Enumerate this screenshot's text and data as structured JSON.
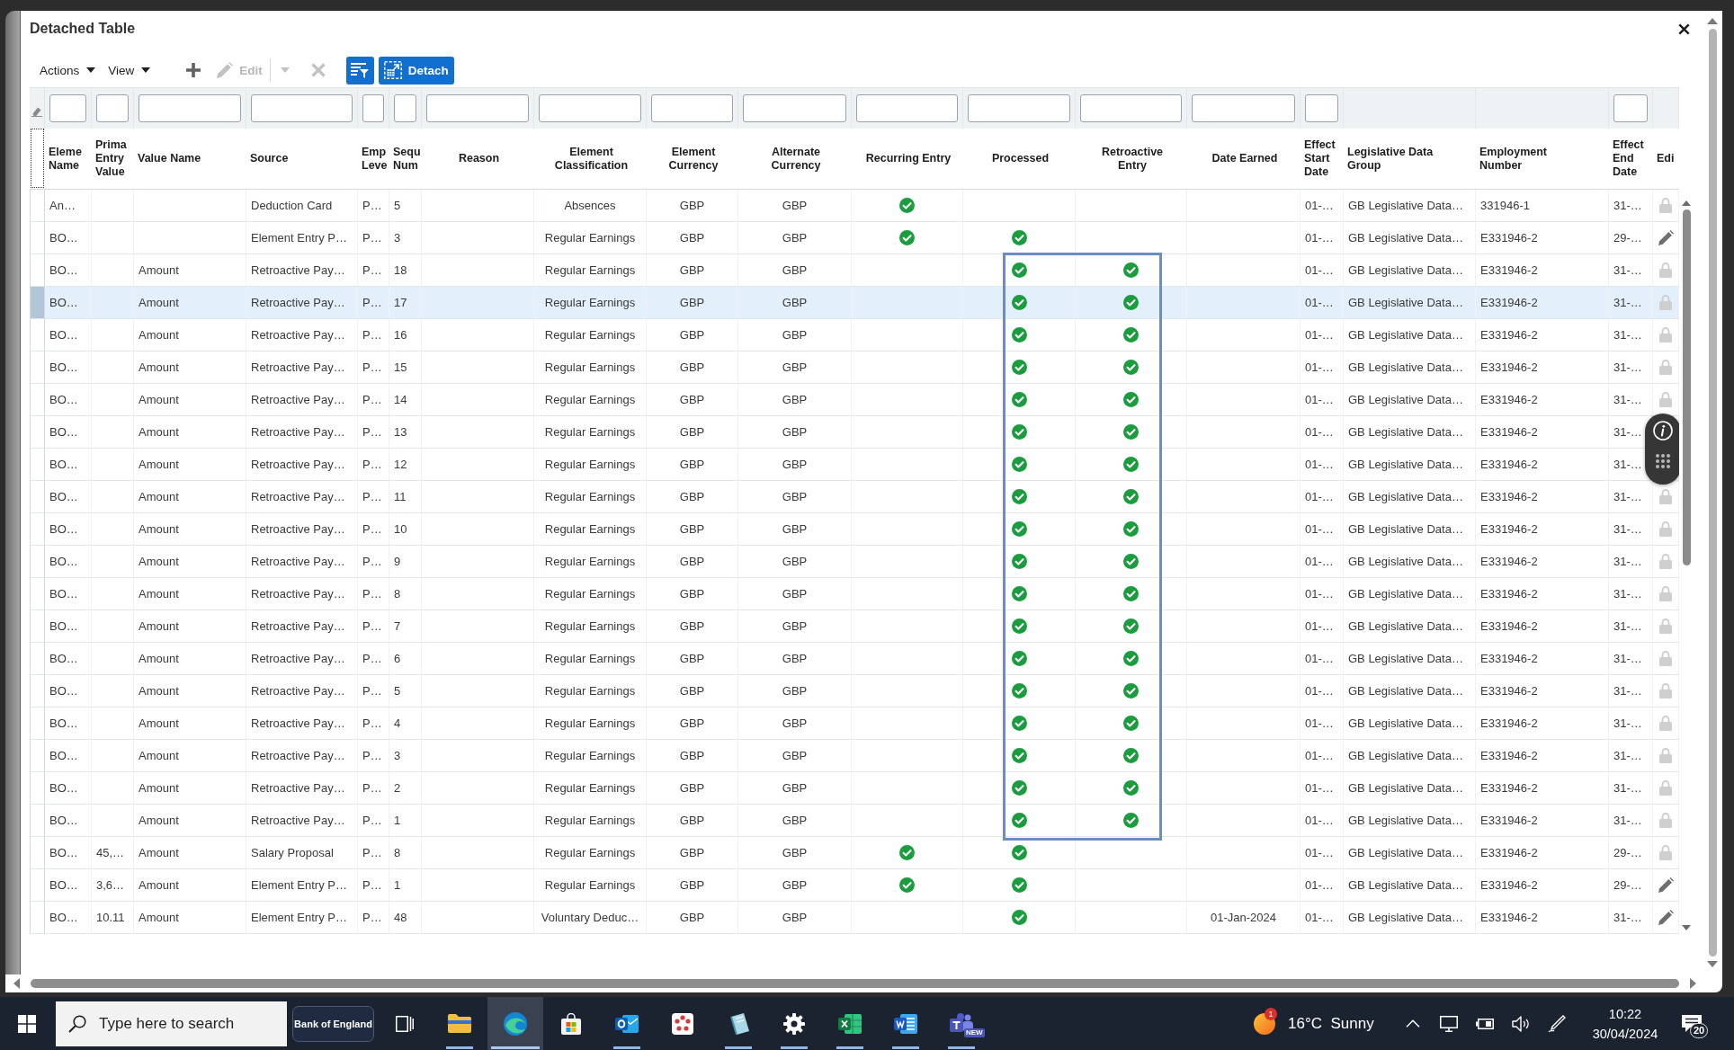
{
  "window": {
    "title": "Detached Table"
  },
  "toolbar": {
    "menus": [
      {
        "label": "Actions"
      },
      {
        "label": "View"
      }
    ],
    "buttons": [
      {
        "kind": "add",
        "disabled": false
      },
      {
        "kind": "edit",
        "label": "Edit",
        "disabled": true
      },
      {
        "kind": "dropdown",
        "disabled": true
      },
      {
        "kind": "delete",
        "disabled": true
      },
      {
        "kind": "filter",
        "disabled": false
      },
      {
        "kind": "detach",
        "label": "Detach",
        "disabled": false
      }
    ]
  },
  "table": {
    "columns": [
      {
        "label": "Eleme\nName",
        "kind": "text",
        "filter": true
      },
      {
        "label": "Prima\nEntry\nValue",
        "kind": "text",
        "filter": true
      },
      {
        "label": "Value Name",
        "kind": "text",
        "filter": true
      },
      {
        "label": "Source",
        "kind": "text",
        "filter": true
      },
      {
        "label": "Emp\nLeve",
        "kind": "text",
        "filter": true
      },
      {
        "label": "Sequ\nNum",
        "kind": "text",
        "filter": true
      },
      {
        "label": "Reason",
        "kind": "text",
        "filter": true
      },
      {
        "label": "Element\nClassification",
        "kind": "text",
        "filter": true
      },
      {
        "label": "Element\nCurrency",
        "kind": "text",
        "filter": true
      },
      {
        "label": "Alternate\nCurrency",
        "kind": "text",
        "filter": true
      },
      {
        "label": "Recurring Entry",
        "kind": "check",
        "filter": true
      },
      {
        "label": "Processed",
        "kind": "check",
        "filter": true
      },
      {
        "label": "Retroactive\nEntry",
        "kind": "check",
        "filter": true
      },
      {
        "label": "Date Earned",
        "kind": "text",
        "filter": true
      },
      {
        "label": "Effect\nStart\nDate",
        "kind": "text",
        "filter": true
      },
      {
        "label": "Legislative Data\nGroup",
        "kind": "text",
        "filter": false
      },
      {
        "label": "Employment\nNumber",
        "kind": "text",
        "filter": false
      },
      {
        "label": "Effect\nEnd\nDate",
        "kind": "text",
        "filter": true
      },
      {
        "label": "Edi",
        "kind": "edit",
        "filter": false
      }
    ],
    "rows": [
      {
        "selected": false,
        "element_name": "An…",
        "source": "Deduction Card",
        "emp_level": "P…",
        "sequence_number": "5",
        "element_classification": "Absences",
        "element_currency": "GBP",
        "alternate_currency": "GBP",
        "recurring_entry": true,
        "processed": false,
        "retroactive_entry": false,
        "effective_start_date": "01-…",
        "legislative_data_group": "GB Legislative Data…",
        "employment_number": "331946-1",
        "effective_end_date": "31-…",
        "editable": false
      },
      {
        "selected": false,
        "element_name": "BO…",
        "source": "Element Entry P…",
        "emp_level": "P…",
        "sequence_number": "3",
        "element_classification": "Regular Earnings",
        "element_currency": "GBP",
        "alternate_currency": "GBP",
        "recurring_entry": true,
        "processed": true,
        "retroactive_entry": false,
        "effective_start_date": "01-…",
        "legislative_data_group": "GB Legislative Data…",
        "employment_number": "E331946-2",
        "effective_end_date": "29-…",
        "editable": true
      },
      {
        "selected": false,
        "element_name": "BO…",
        "value_name": "Amount",
        "source": "Retroactive Pay…",
        "emp_level": "P…",
        "sequence_number": "18",
        "element_classification": "Regular Earnings",
        "element_currency": "GBP",
        "alternate_currency": "GBP",
        "recurring_entry": false,
        "processed": true,
        "retroactive_entry": true,
        "effective_start_date": "01-…",
        "legislative_data_group": "GB Legislative Data…",
        "employment_number": "E331946-2",
        "effective_end_date": "31-…",
        "editable": false
      },
      {
        "selected": true,
        "element_name": "BO…",
        "value_name": "Amount",
        "source": "Retroactive Pay…",
        "emp_level": "P…",
        "sequence_number": "17",
        "element_classification": "Regular Earnings",
        "element_currency": "GBP",
        "alternate_currency": "GBP",
        "recurring_entry": false,
        "processed": true,
        "retroactive_entry": true,
        "effective_start_date": "01-…",
        "legislative_data_group": "GB Legislative Data…",
        "employment_number": "E331946-2",
        "effective_end_date": "31-…",
        "editable": false
      },
      {
        "selected": false,
        "element_name": "BO…",
        "value_name": "Amount",
        "source": "Retroactive Pay…",
        "emp_level": "P…",
        "sequence_number": "16",
        "element_classification": "Regular Earnings",
        "element_currency": "GBP",
        "alternate_currency": "GBP",
        "recurring_entry": false,
        "processed": true,
        "retroactive_entry": true,
        "effective_start_date": "01-…",
        "legislative_data_group": "GB Legislative Data…",
        "employment_number": "E331946-2",
        "effective_end_date": "31-…",
        "editable": false
      },
      {
        "selected": false,
        "element_name": "BO…",
        "value_name": "Amount",
        "source": "Retroactive Pay…",
        "emp_level": "P…",
        "sequence_number": "15",
        "element_classification": "Regular Earnings",
        "element_currency": "GBP",
        "alternate_currency": "GBP",
        "recurring_entry": false,
        "processed": true,
        "retroactive_entry": true,
        "effective_start_date": "01-…",
        "legislative_data_group": "GB Legislative Data…",
        "employment_number": "E331946-2",
        "effective_end_date": "31-…",
        "editable": false
      },
      {
        "selected": false,
        "element_name": "BO…",
        "value_name": "Amount",
        "source": "Retroactive Pay…",
        "emp_level": "P…",
        "sequence_number": "14",
        "element_classification": "Regular Earnings",
        "element_currency": "GBP",
        "alternate_currency": "GBP",
        "recurring_entry": false,
        "processed": true,
        "retroactive_entry": true,
        "effective_start_date": "01-…",
        "legislative_data_group": "GB Legislative Data…",
        "employment_number": "E331946-2",
        "effective_end_date": "31-…",
        "editable": false
      },
      {
        "selected": false,
        "element_name": "BO…",
        "value_name": "Amount",
        "source": "Retroactive Pay…",
        "emp_level": "P…",
        "sequence_number": "13",
        "element_classification": "Regular Earnings",
        "element_currency": "GBP",
        "alternate_currency": "GBP",
        "recurring_entry": false,
        "processed": true,
        "retroactive_entry": true,
        "effective_start_date": "01-…",
        "legislative_data_group": "GB Legislative Data…",
        "employment_number": "E331946-2",
        "effective_end_date": "31-…"
      },
      {
        "selected": false,
        "element_name": "BO…",
        "value_name": "Amount",
        "source": "Retroactive Pay…",
        "emp_level": "P…",
        "sequence_number": "12",
        "element_classification": "Regular Earnings",
        "element_currency": "GBP",
        "alternate_currency": "GBP",
        "recurring_entry": false,
        "processed": true,
        "retroactive_entry": true,
        "effective_start_date": "01-…",
        "legislative_data_group": "GB Legislative Data…",
        "employment_number": "E331946-2",
        "effective_end_date": "31-…"
      },
      {
        "selected": false,
        "element_name": "BO…",
        "value_name": "Amount",
        "source": "Retroactive Pay…",
        "emp_level": "P…",
        "sequence_number": "11",
        "element_classification": "Regular Earnings",
        "element_currency": "GBP",
        "alternate_currency": "GBP",
        "recurring_entry": false,
        "processed": true,
        "retroactive_entry": true,
        "effective_start_date": "01-…",
        "legislative_data_group": "GB Legislative Data…",
        "employment_number": "E331946-2",
        "effective_end_date": "31-…",
        "editable": false
      },
      {
        "selected": false,
        "element_name": "BO…",
        "value_name": "Amount",
        "source": "Retroactive Pay…",
        "emp_level": "P…",
        "sequence_number": "10",
        "element_classification": "Regular Earnings",
        "element_currency": "GBP",
        "alternate_currency": "GBP",
        "recurring_entry": false,
        "processed": true,
        "retroactive_entry": true,
        "effective_start_date": "01-…",
        "legislative_data_group": "GB Legislative Data…",
        "employment_number": "E331946-2",
        "effective_end_date": "31-…",
        "editable": false
      },
      {
        "selected": false,
        "element_name": "BO…",
        "value_name": "Amount",
        "source": "Retroactive Pay…",
        "emp_level": "P…",
        "sequence_number": "9",
        "element_classification": "Regular Earnings",
        "element_currency": "GBP",
        "alternate_currency": "GBP",
        "recurring_entry": false,
        "processed": true,
        "retroactive_entry": true,
        "effective_start_date": "01-…",
        "legislative_data_group": "GB Legislative Data…",
        "employment_number": "E331946-2",
        "effective_end_date": "31-…",
        "editable": false
      },
      {
        "selected": false,
        "element_name": "BO…",
        "value_name": "Amount",
        "source": "Retroactive Pay…",
        "emp_level": "P…",
        "sequence_number": "8",
        "element_classification": "Regular Earnings",
        "element_currency": "GBP",
        "alternate_currency": "GBP",
        "recurring_entry": false,
        "processed": true,
        "retroactive_entry": true,
        "effective_start_date": "01-…",
        "legislative_data_group": "GB Legislative Data…",
        "employment_number": "E331946-2",
        "effective_end_date": "31-…",
        "editable": false
      },
      {
        "selected": false,
        "element_name": "BO…",
        "value_name": "Amount",
        "source": "Retroactive Pay…",
        "emp_level": "P…",
        "sequence_number": "7",
        "element_classification": "Regular Earnings",
        "element_currency": "GBP",
        "alternate_currency": "GBP",
        "recurring_entry": false,
        "processed": true,
        "retroactive_entry": true,
        "effective_start_date": "01-…",
        "legislative_data_group": "GB Legislative Data…",
        "employment_number": "E331946-2",
        "effective_end_date": "31-…",
        "editable": false
      },
      {
        "selected": false,
        "element_name": "BO…",
        "value_name": "Amount",
        "source": "Retroactive Pay…",
        "emp_level": "P…",
        "sequence_number": "6",
        "element_classification": "Regular Earnings",
        "element_currency": "GBP",
        "alternate_currency": "GBP",
        "recurring_entry": false,
        "processed": true,
        "retroactive_entry": true,
        "effective_start_date": "01-…",
        "legislative_data_group": "GB Legislative Data…",
        "employment_number": "E331946-2",
        "effective_end_date": "31-…",
        "editable": false
      },
      {
        "selected": false,
        "element_name": "BO…",
        "value_name": "Amount",
        "source": "Retroactive Pay…",
        "emp_level": "P…",
        "sequence_number": "5",
        "element_classification": "Regular Earnings",
        "element_currency": "GBP",
        "alternate_currency": "GBP",
        "recurring_entry": false,
        "processed": true,
        "retroactive_entry": true,
        "effective_start_date": "01-…",
        "legislative_data_group": "GB Legislative Data…",
        "employment_number": "E331946-2",
        "effective_end_date": "31-…",
        "editable": false
      },
      {
        "selected": false,
        "element_name": "BO…",
        "value_name": "Amount",
        "source": "Retroactive Pay…",
        "emp_level": "P…",
        "sequence_number": "4",
        "element_classification": "Regular Earnings",
        "element_currency": "GBP",
        "alternate_currency": "GBP",
        "recurring_entry": false,
        "processed": true,
        "retroactive_entry": true,
        "effective_start_date": "01-…",
        "legislative_data_group": "GB Legislative Data…",
        "employment_number": "E331946-2",
        "effective_end_date": "31-…",
        "editable": false
      },
      {
        "selected": false,
        "element_name": "BO…",
        "value_name": "Amount",
        "source": "Retroactive Pay…",
        "emp_level": "P…",
        "sequence_number": "3",
        "element_classification": "Regular Earnings",
        "element_currency": "GBP",
        "alternate_currency": "GBP",
        "recurring_entry": false,
        "processed": true,
        "retroactive_entry": true,
        "effective_start_date": "01-…",
        "legislative_data_group": "GB Legislative Data…",
        "employment_number": "E331946-2",
        "effective_end_date": "31-…",
        "editable": false
      },
      {
        "selected": false,
        "element_name": "BO…",
        "value_name": "Amount",
        "source": "Retroactive Pay…",
        "emp_level": "P…",
        "sequence_number": "2",
        "element_classification": "Regular Earnings",
        "element_currency": "GBP",
        "alternate_currency": "GBP",
        "recurring_entry": false,
        "processed": true,
        "retroactive_entry": true,
        "effective_start_date": "01-…",
        "legislative_data_group": "GB Legislative Data…",
        "employment_number": "E331946-2",
        "effective_end_date": "31-…",
        "editable": false
      },
      {
        "selected": false,
        "element_name": "BO…",
        "value_name": "Amount",
        "source": "Retroactive Pay…",
        "emp_level": "P…",
        "sequence_number": "1",
        "element_classification": "Regular Earnings",
        "element_currency": "GBP",
        "alternate_currency": "GBP",
        "recurring_entry": false,
        "processed": true,
        "retroactive_entry": true,
        "effective_start_date": "01-…",
        "legislative_data_group": "GB Legislative Data…",
        "employment_number": "E331946-2",
        "effective_end_date": "31-…",
        "editable": false
      },
      {
        "selected": false,
        "element_name": "BO…",
        "primary_entry_value": "45,…",
        "value_name": "Amount",
        "source": "Salary Proposal",
        "emp_level": "P…",
        "sequence_number": "8",
        "element_classification": "Regular Earnings",
        "element_currency": "GBP",
        "alternate_currency": "GBP",
        "recurring_entry": true,
        "processed": true,
        "retroactive_entry": false,
        "effective_start_date": "01-…",
        "legislative_data_group": "GB Legislative Data…",
        "employment_number": "E331946-2",
        "effective_end_date": "29-…",
        "editable": false
      },
      {
        "selected": false,
        "element_name": "BO…",
        "primary_entry_value": "3,6…",
        "value_name": "Amount",
        "source": "Element Entry P…",
        "emp_level": "P…",
        "sequence_number": "1",
        "element_classification": "Regular Earnings",
        "element_currency": "GBP",
        "alternate_currency": "GBP",
        "recurring_entry": true,
        "processed": true,
        "retroactive_entry": false,
        "effective_start_date": "01-…",
        "legislative_data_group": "GB Legislative Data…",
        "employment_number": "E331946-2",
        "effective_end_date": "29-…",
        "editable": true
      },
      {
        "selected": false,
        "element_name": "BO…",
        "primary_entry_value": "10.11",
        "value_name": "Amount",
        "source": "Element Entry P…",
        "emp_level": "P…",
        "sequence_number": "48",
        "element_classification": "Voluntary Deduc…",
        "element_currency": "GBP",
        "alternate_currency": "GBP",
        "recurring_entry": false,
        "processed": true,
        "retroactive_entry": false,
        "date_earned": "01-Jan-2024",
        "effective_start_date": "01-…",
        "legislative_data_group": "GB Legislative Data…",
        "employment_number": "E331946-2",
        "effective_end_date": "31-…",
        "editable": true
      }
    ]
  },
  "annotation": {
    "kind": "rectangle"
  },
  "taskbar": {
    "search": {
      "placeholder": "Type here to search"
    },
    "news": {
      "label": "Bank of England"
    },
    "apps": [
      {
        "kind": "files",
        "running": true,
        "selected": false
      },
      {
        "kind": "browser",
        "running": true,
        "selected": true
      },
      {
        "kind": "store",
        "running": false,
        "selected": false
      },
      {
        "kind": "mail",
        "running": true,
        "selected": false
      },
      {
        "kind": "people",
        "running": false,
        "selected": false
      },
      {
        "kind": "notebook",
        "running": true,
        "selected": false
      },
      {
        "kind": "settings",
        "running": true,
        "selected": false
      },
      {
        "kind": "spreadsheet",
        "running": true,
        "selected": false
      },
      {
        "kind": "document",
        "running": true,
        "selected": false
      },
      {
        "kind": "chat",
        "running": true,
        "selected": false,
        "badge": "NEW"
      }
    ],
    "weather": {
      "badge": "1",
      "temperature": "16°C",
      "condition": "Sunny"
    },
    "clock": {
      "time": "10:22",
      "date": "30/04/2024"
    },
    "notifications": {
      "count": "20"
    }
  }
}
